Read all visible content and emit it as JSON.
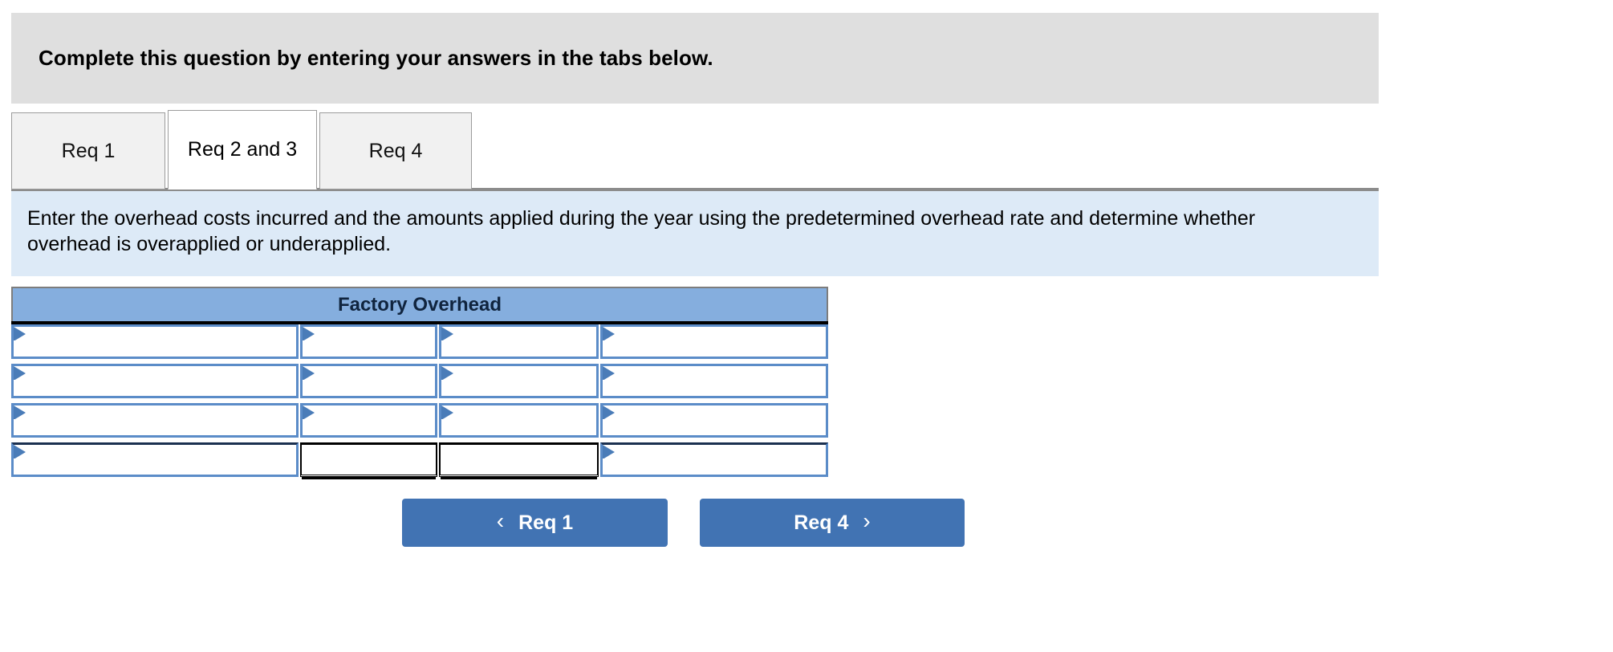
{
  "question_band": {
    "title": "Complete this question by entering your answers in the tabs below."
  },
  "tabs": [
    {
      "label": "Req 1",
      "active": false
    },
    {
      "label": "Req 2 and 3",
      "active": true
    },
    {
      "label": "Req 4",
      "active": false
    }
  ],
  "instruction": {
    "text": "Enter the overhead costs incurred and the amounts applied during the year using the predetermined overhead rate and determine whether overhead is overapplied or underapplied."
  },
  "table": {
    "title": "Factory Overhead",
    "rows": [
      {
        "cells": [
          {
            "value": ""
          },
          {
            "value": ""
          },
          {
            "value": ""
          },
          {
            "value": ""
          }
        ]
      },
      {
        "cells": [
          {
            "value": ""
          },
          {
            "value": ""
          },
          {
            "value": ""
          },
          {
            "value": ""
          }
        ]
      },
      {
        "cells": [
          {
            "value": ""
          },
          {
            "value": ""
          },
          {
            "value": ""
          },
          {
            "value": ""
          }
        ]
      },
      {
        "cells": [
          {
            "value": ""
          },
          {
            "value": ""
          },
          {
            "value": ""
          },
          {
            "value": ""
          }
        ]
      }
    ]
  },
  "navigation": {
    "prev_label": "Req 1",
    "prev_icon": "chevron-left-icon",
    "next_label": "Req 4",
    "next_icon": "chevron-right-icon"
  },
  "colors": {
    "band_gray": "#dfdfdf",
    "instruction_blue": "#ddeaf7",
    "table_header_blue": "#85aede",
    "cell_border_blue": "#5b8cc8",
    "button_blue": "#4173b3",
    "tab_inactive": "#f1f1f1"
  }
}
